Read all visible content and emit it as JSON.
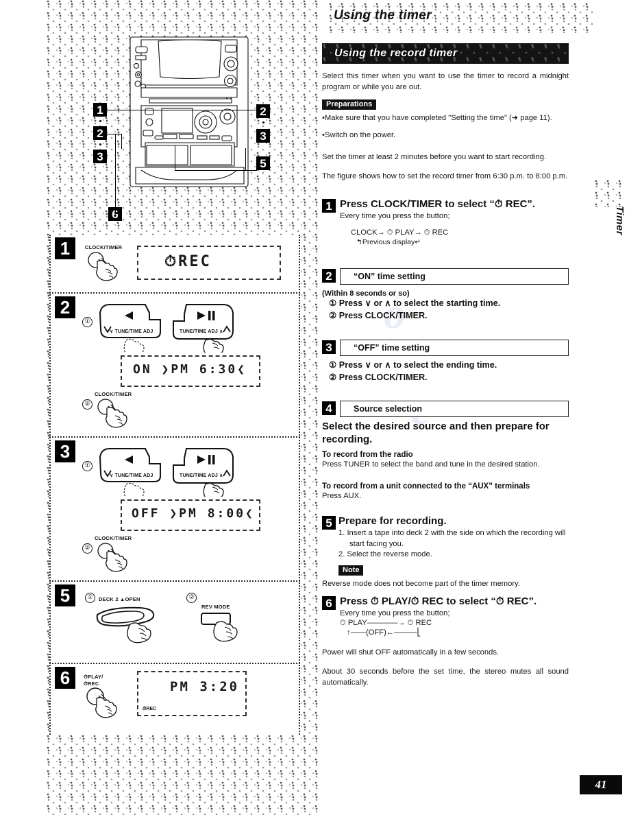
{
  "page": {
    "number": "41",
    "side_tab_label": "Timer",
    "header_title": "Using the timer",
    "section_bar_title": "Using the record timer"
  },
  "intro": {
    "paragraph": "Select this timer when you want to use the timer to record a midnight program or while you are out.",
    "preparations_label": "Preparations",
    "prep_bullet_1": "Make sure that you have completed \"Setting the time\" (➜ page 11).",
    "prep_bullet_2": "Switch on the power.",
    "note_time": "Set the timer at least 2 minutes before you want to start recording.",
    "figure_note": "The figure shows how to set the record timer from 6:30 p.m. to 8:00 p.m."
  },
  "steps": [
    {
      "num": "1",
      "title": "Press CLOCK/TIMER to select “⏱ REC”.",
      "sub": "Every time you press the button;",
      "cycle_line1": "CLOCK→ ⏱ PLAY→ ⏱ REC",
      "cycle_line2": "Previous display"
    },
    {
      "num": "2",
      "box_label": "“ON” time setting",
      "within": "(Within 8 seconds or so)",
      "item1": "Press ∨ or ∧ to select the starting time.",
      "item2": "Press CLOCK/TIMER."
    },
    {
      "num": "3",
      "box_label": "“OFF” time setting",
      "item1": "Press ∨ or ∧ to select the ending time.",
      "item2": "Press CLOCK/TIMER."
    },
    {
      "num": "4",
      "box_label": "Source selection",
      "lead": "Select the desired source and then prepare for recording.",
      "radio_head": "To record from the radio",
      "radio_body": "Press TUNER to select the band and tune in the desired station.",
      "aux_head": "To record from a unit connected to the “AUX” terminals",
      "aux_body": "Press AUX."
    },
    {
      "num": "5",
      "title": "Prepare for recording.",
      "item1": "1.  Insert a tape into deck 2 with the side on which the recording will start facing you.",
      "item2": "2.  Select the reverse mode.",
      "note_label": "Note",
      "note_body": "Reverse mode does not become part of the timer memory."
    },
    {
      "num": "6",
      "title": "Press ⏱ PLAY/⏱ REC to select “⏱ REC”.",
      "sub": "Every time you press the button;",
      "cycle_line1": "⏱ PLAY",
      "cycle_arrow": "⏱ REC",
      "cycle_line2": "(OFF)",
      "after1": "Power will shut OFF automatically in a few seconds.",
      "after2": "About 30 seconds before the set time, the stereo mutes all sound automatically."
    }
  ],
  "figure": {
    "callouts": [
      "1",
      "2",
      "3",
      "2",
      "3",
      "5",
      "6"
    ],
    "panels": [
      {
        "num": "1",
        "button_label": "CLOCK/TIMER",
        "display_text": "⏱REC"
      },
      {
        "num": "2",
        "circle1": "①",
        "circle2": "②",
        "button_left_label": "∨ TUNE/TIME ADJ",
        "button_left_glyph": "◀",
        "button_right_label": "TUNE/TIME ADJ ∧",
        "button_right_glyph": "▶/II",
        "button2_label": "CLOCK/TIMER",
        "display_text": "ON  ❯PM  6:30❮"
      },
      {
        "num": "3",
        "circle1": "①",
        "circle2": "②",
        "button_left_label": "∨ TUNE/TIME ADJ",
        "button_left_glyph": "◀",
        "button_right_label": "TUNE/TIME ADJ ∧",
        "button_right_glyph": "▶/II",
        "button2_label": "CLOCK/TIMER",
        "display_text": "OFF ❯PM  8:00❮"
      },
      {
        "num": "5",
        "circle1": "①",
        "circle2": "②",
        "button1_label": "DECK 2 ▲OPEN",
        "button2_label": "REV MODE"
      },
      {
        "num": "6",
        "button_label_line1": "⏱PLAY/",
        "button_label_line2": "⏱REC",
        "display_text": "PM  3:20",
        "display_indicator": "⏱REC"
      }
    ]
  },
  "colors": {
    "ink": "#111111",
    "paper": "#ffffff",
    "bar": "#0a0a0a"
  }
}
